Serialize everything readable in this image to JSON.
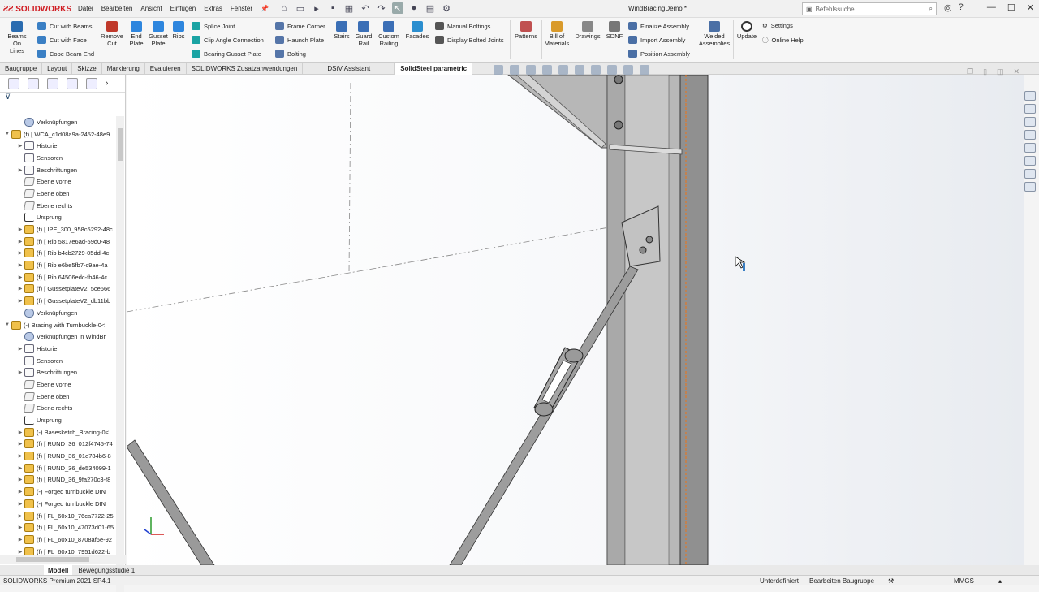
{
  "app": {
    "brand": "SOLIDWORKS",
    "doc_title": "WindBracingDemo *"
  },
  "menu": [
    "Datei",
    "Bearbeiten",
    "Ansicht",
    "Einfügen",
    "Extras",
    "Fenster"
  ],
  "search": {
    "placeholder": "Befehlssuche"
  },
  "ribbon": {
    "beams_on_lines": "Beams On Lines",
    "cut_with_beams": "Cut with Beams",
    "cut_with_face": "Cut with Face",
    "cope_beam_end": "Cope Beam End",
    "remove_cut": "Remove Cut",
    "end_plate": "End Plate",
    "gusset_plate": "Gusset Plate",
    "ribs": "Ribs",
    "splice_joint": "Splice Joint",
    "clip_angle_connection": "Clip Angle Connection",
    "bearing_gusset_plate": "Bearing Gusset Plate",
    "frame_corner": "Frame Corner",
    "haunch_plate": "Haunch Plate",
    "bolting": "Bolting",
    "stairs": "Stairs",
    "guard_rail": "Guard Rail",
    "custom_railing": "Custom Railing",
    "facades": "Facades",
    "manual_boltings": "Manual Boltings",
    "display_bolted_joints": "Display Bolted Joints",
    "patterns": "Patterns",
    "bill_of_materials": "Bill of Materials",
    "drawings": "Drawings",
    "sdnf": "SDNF",
    "finalize_assembly": "Finalize Assembly",
    "import_assembly": "Import Assembly",
    "position_assembly": "Position Assembly",
    "welded_assemblies": "Welded Assemblies",
    "update": "Update",
    "settings": "Settings",
    "online_help": "Online Help"
  },
  "tabs": [
    "Baugruppe",
    "Layout",
    "Skizze",
    "Markierung",
    "Evaluieren",
    "SOLIDWORKS Zusatzanwendungen",
    "DStV Assistant",
    "SolidSteel parametric"
  ],
  "active_tab": "SolidSteel parametric",
  "tree": [
    {
      "label": "Verknüpfungen",
      "icon": "mates",
      "level": 2,
      "exp": ""
    },
    {
      "label": "(f) [ WCA_c1d08a9a-2452-48e9",
      "icon": "asm",
      "level": 1,
      "exp": "▼"
    },
    {
      "label": "Historie",
      "icon": "fld",
      "level": 2,
      "exp": "▶"
    },
    {
      "label": "Sensoren",
      "icon": "fld",
      "level": 2,
      "exp": ""
    },
    {
      "label": "Beschriftungen",
      "icon": "fld",
      "level": 2,
      "exp": "▶"
    },
    {
      "label": "Ebene vorne",
      "icon": "plane",
      "level": 2,
      "exp": ""
    },
    {
      "label": "Ebene oben",
      "icon": "plane",
      "level": 2,
      "exp": ""
    },
    {
      "label": "Ebene rechts",
      "icon": "plane",
      "level": 2,
      "exp": ""
    },
    {
      "label": "Ursprung",
      "icon": "origin",
      "level": 2,
      "exp": ""
    },
    {
      "label": "(f) [ IPE_300_958c5292-48c",
      "icon": "asm",
      "level": 2,
      "exp": "▶"
    },
    {
      "label": "(f) [ Rib 5817e6ad-59d0-48",
      "icon": "asm",
      "level": 2,
      "exp": "▶"
    },
    {
      "label": "(f) [ Rib b4cb2729-05dd-4c",
      "icon": "asm",
      "level": 2,
      "exp": "▶"
    },
    {
      "label": "(f) [ Rib e6be5fb7-c9ae-4a",
      "icon": "asm",
      "level": 2,
      "exp": "▶"
    },
    {
      "label": "(f) [ Rib 64506edc-fb46-4c",
      "icon": "asm",
      "level": 2,
      "exp": "▶"
    },
    {
      "label": "(f) [ GussetplateV2_5ce666",
      "icon": "asm",
      "level": 2,
      "exp": "▶"
    },
    {
      "label": "(f) [ GussetplateV2_db11bb",
      "icon": "asm",
      "level": 2,
      "exp": "▶"
    },
    {
      "label": "Verknüpfungen",
      "icon": "mates",
      "level": 2,
      "exp": ""
    },
    {
      "label": "(-) Bracing with Turnbuckle-0<",
      "icon": "asm",
      "level": 1,
      "exp": "▼"
    },
    {
      "label": "Verknüpfungen in WindBr",
      "icon": "mates",
      "level": 2,
      "exp": ""
    },
    {
      "label": "Historie",
      "icon": "fld",
      "level": 2,
      "exp": "▶"
    },
    {
      "label": "Sensoren",
      "icon": "fld",
      "level": 2,
      "exp": ""
    },
    {
      "label": "Beschriftungen",
      "icon": "fld",
      "level": 2,
      "exp": "▶"
    },
    {
      "label": "Ebene vorne",
      "icon": "plane",
      "level": 2,
      "exp": ""
    },
    {
      "label": "Ebene oben",
      "icon": "plane",
      "level": 2,
      "exp": ""
    },
    {
      "label": "Ebene rechts",
      "icon": "plane",
      "level": 2,
      "exp": ""
    },
    {
      "label": "Ursprung",
      "icon": "origin",
      "level": 2,
      "exp": ""
    },
    {
      "label": "(-) Basesketch_Bracing-0<",
      "icon": "asm",
      "level": 2,
      "exp": "▶"
    },
    {
      "label": "(f) [ RUND_36_012f4745-74",
      "icon": "asm",
      "level": 2,
      "exp": "▶"
    },
    {
      "label": "(f) [ RUND_36_01e784b6-8",
      "icon": "asm",
      "level": 2,
      "exp": "▶"
    },
    {
      "label": "(f) [ RUND_36_de534099-1",
      "icon": "asm",
      "level": 2,
      "exp": "▶"
    },
    {
      "label": "(f) [ RUND_36_9fa270c3-f8",
      "icon": "asm",
      "level": 2,
      "exp": "▶"
    },
    {
      "label": "(-) Forged turnbuckle DIN",
      "icon": "asm",
      "level": 2,
      "exp": "▶"
    },
    {
      "label": "(-) Forged turnbuckle DIN",
      "icon": "asm",
      "level": 2,
      "exp": "▶"
    },
    {
      "label": "(f) [ FL_60x10_76ca7722-25",
      "icon": "asm",
      "level": 2,
      "exp": "▶"
    },
    {
      "label": "(f) [ FL_60x10_47073d01-65",
      "icon": "asm",
      "level": 2,
      "exp": "▶"
    },
    {
      "label": "(f) [ FL_60x10_8708af6e-92",
      "icon": "asm",
      "level": 2,
      "exp": "▶"
    },
    {
      "label": "(f) [ FL_60x10_7951d622-b",
      "icon": "asm",
      "level": 2,
      "exp": "▶"
    }
  ],
  "bottom_tabs": [
    "Modell",
    "Bewegungsstudie 1"
  ],
  "status": {
    "product": "SOLIDWORKS Premium 2021 SP4.1",
    "state": "Unterdefiniert",
    "mode": "Bearbeiten Baugruppe",
    "units": "MMGS"
  },
  "colors": {
    "brand_red": "#d01a20",
    "beam_grey": "#9a9a9a",
    "selection_orange": "#e07a2a"
  }
}
